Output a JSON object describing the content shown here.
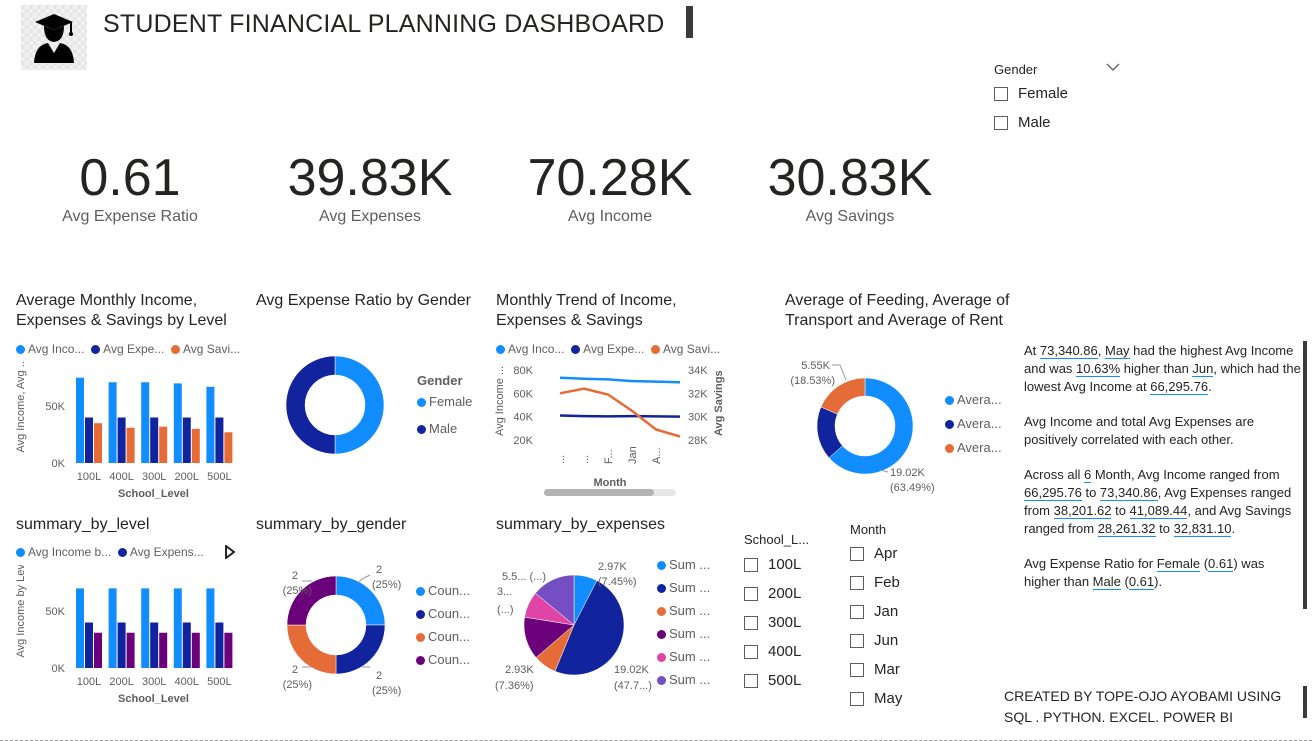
{
  "header": {
    "title": "STUDENT FINANCIAL PLANNING DASHBOARD",
    "logo_icon": "graduate-icon"
  },
  "kpis": [
    {
      "value": "0.61",
      "label": "Avg Expense Ratio"
    },
    {
      "value": "39.83K",
      "label": "Avg Expenses"
    },
    {
      "value": "70.28K",
      "label": "Avg Income"
    },
    {
      "value": "30.83K",
      "label": "Avg Savings"
    }
  ],
  "gender_slicer": {
    "title": "Gender",
    "options": [
      "Female",
      "Male"
    ]
  },
  "school_slicer": {
    "title": "School_L...",
    "options": [
      "100L",
      "200L",
      "300L",
      "400L",
      "500L"
    ]
  },
  "month_slicer": {
    "title": "Month",
    "options": [
      "Apr",
      "Feb",
      "Jan",
      "Jun",
      "Mar",
      "May"
    ]
  },
  "colors": {
    "blue": "#118dff",
    "navy": "#12239e",
    "orange": "#e66c37",
    "purple": "#6b007b",
    "pink": "#e044a7",
    "violet": "#744ec2"
  },
  "visuals": {
    "level_chart": {
      "title": "Average Monthly Income, Expenses & Savings by Level",
      "legend": [
        "Avg Inco...",
        "Avg Expe...",
        "Avg Savi..."
      ],
      "ylabel": "Avg Income, Avg ...",
      "xlabel": "School_Level",
      "yticks": [
        "50K",
        "0K"
      ]
    },
    "gender_donut": {
      "title": "Avg Expense Ratio by Gender",
      "legend_title": "Gender",
      "legend": [
        "Female",
        "Male"
      ]
    },
    "trend_chart": {
      "title": "Monthly Trend of Income, Expenses & Savings",
      "legend": [
        "Avg Inco...",
        "Avg Expe...",
        "Avg Savi..."
      ],
      "ylabel_left": "Avg Income ...",
      "ylabel_right": "Avg Savings",
      "xlabel": "Month",
      "yticks_left": [
        "80K",
        "60K",
        "40K",
        "20K"
      ],
      "yticks_right": [
        "34K",
        "32K",
        "30K",
        "28K"
      ],
      "xticks": [
        "...",
        "...",
        "F...",
        "Jan",
        "A..."
      ]
    },
    "feeding_donut": {
      "title": "Average of Feeding, Average of Transport and Average of Rent",
      "legend": [
        "Avera...",
        "Avera...",
        "Avera..."
      ],
      "label_top": "5.55K",
      "label_top_pct": "(18.53%)",
      "label_bottom": "19.02K",
      "label_bottom_pct": "(63.49%)"
    },
    "summary_level": {
      "title": "summary_by_level",
      "legend": [
        "Avg Income b...",
        "Avg Expens..."
      ],
      "ylabel": "Avg Income by Level...",
      "xlabel": "School_Level",
      "yticks": [
        "50K",
        "0K"
      ]
    },
    "summary_gender": {
      "title": "summary_by_gender",
      "legend": [
        "Coun...",
        "Coun...",
        "Coun...",
        "Coun..."
      ],
      "labels": [
        "2",
        "(25%)"
      ]
    },
    "summary_expenses": {
      "title": "summary_by_expenses",
      "legend": [
        "Sum ...",
        "Sum ...",
        "Sum ...",
        "Sum ...",
        "Sum ...",
        "Sum ..."
      ],
      "label_a": "2.97K",
      "label_a_pct": "(7.45%)",
      "label_b": "5.5...",
      "label_b_pct": "(...)",
      "label_c": "3...",
      "label_c_pct": "(...)",
      "label_d": "2.93K",
      "label_d_pct": "(7.36%)",
      "label_e": "19.02K",
      "label_e_pct": "(47.7...)"
    }
  },
  "narrative": {
    "p1": [
      "At ",
      "73,340.86",
      ", ",
      "May",
      " had the highest Avg Income and was ",
      "10.63%",
      " higher than ",
      "Jun",
      ", which had the lowest Avg Income at ",
      "66,295.76",
      "."
    ],
    "p2": "Avg Income and total Avg Expenses are positively correlated with each other.",
    "p3": [
      "Across all ",
      "6",
      " Month, Avg Income ranged from ",
      "66,295.76",
      " to ",
      "73,340.86",
      ", Avg Expenses ranged from ",
      "38,201.62",
      " to ",
      "41,089.44",
      ", and Avg Savings ranged from ",
      "28,261.32",
      " to ",
      "32,831.10",
      "."
    ],
    "p4": [
      "Avg Expense Ratio for ",
      "Female",
      " (",
      "0.61",
      ") was higher than ",
      "Male",
      " (",
      "0.61",
      ")."
    ]
  },
  "footer": {
    "credit": "CREATED BY TOPE-OJO AYOBAMI USING SQL . PYTHON. EXCEL. POWER BI"
  },
  "chart_data": [
    {
      "type": "bar",
      "title": "Average Monthly Income, Expenses & Savings by Level",
      "categories": [
        "100L",
        "400L",
        "300L",
        "200L",
        "500L"
      ],
      "series": [
        {
          "name": "Avg Inco...",
          "values": [
            75000,
            71000,
            71000,
            70000,
            67000
          ]
        },
        {
          "name": "Avg Expe...",
          "values": [
            40000,
            40000,
            40000,
            40000,
            40000
          ]
        },
        {
          "name": "Avg Savi...",
          "values": [
            35000,
            31000,
            32000,
            30000,
            27000
          ]
        }
      ],
      "xlabel": "School_Level",
      "ylabel": "Avg Income, Avg ...",
      "ylim": [
        0,
        80000
      ]
    },
    {
      "type": "pie",
      "title": "Avg Expense Ratio by Gender",
      "categories": [
        "Female",
        "Male"
      ],
      "values": [
        0.61,
        0.61
      ]
    },
    {
      "type": "line",
      "title": "Monthly Trend of Income, Expenses & Savings",
      "x": [
        "...",
        "...",
        "F...",
        "Jan",
        "A..."
      ],
      "series": [
        {
          "name": "Avg Inco...",
          "values": [
            73340,
            72500,
            72000,
            70500,
            70000,
            69500
          ]
        },
        {
          "name": "Avg Expe...",
          "values": [
            41000,
            40500,
            40300,
            40500,
            40200,
            40000
          ]
        },
        {
          "name": "Avg Savi...",
          "values": [
            32000,
            32400,
            31900,
            30500,
            28900,
            28300
          ]
        }
      ],
      "ylim_left": [
        20000,
        80000
      ],
      "ylim_right": [
        28000,
        34000
      ]
    },
    {
      "type": "pie",
      "title": "Average of Feeding, Average of Transport and Average of Rent",
      "categories": [
        "Avera...",
        "Avera...",
        "Avera..."
      ],
      "values": [
        19020,
        5390,
        5550
      ]
    },
    {
      "type": "bar",
      "title": "summary_by_level",
      "categories": [
        "100L",
        "200L",
        "300L",
        "400L",
        "500L"
      ],
      "series": [
        {
          "name": "Avg Income b...",
          "values": [
            70000,
            70000,
            70000,
            70000,
            70000
          ]
        },
        {
          "name": "Avg Expens...",
          "values": [
            40000,
            40000,
            40000,
            40000,
            40000
          ]
        },
        {
          "values": [
            31000,
            31000,
            31000,
            31000,
            31000
          ]
        }
      ],
      "xlabel": "School_Level",
      "ylabel": "Avg Income by Level...",
      "ylim": [
        0,
        80000
      ]
    },
    {
      "type": "pie",
      "title": "summary_by_gender",
      "categories": [
        "Coun...",
        "Coun...",
        "Coun...",
        "Coun..."
      ],
      "values": [
        2,
        2,
        2,
        2
      ]
    },
    {
      "type": "pie",
      "title": "summary_by_expenses",
      "categories": [
        "Sum ...",
        "Sum ...",
        "Sum ...",
        "Sum ...",
        "Sum ...",
        "Sum ..."
      ],
      "values": [
        2970,
        19020,
        2930,
        5400,
        3300,
        5500
      ]
    }
  ]
}
